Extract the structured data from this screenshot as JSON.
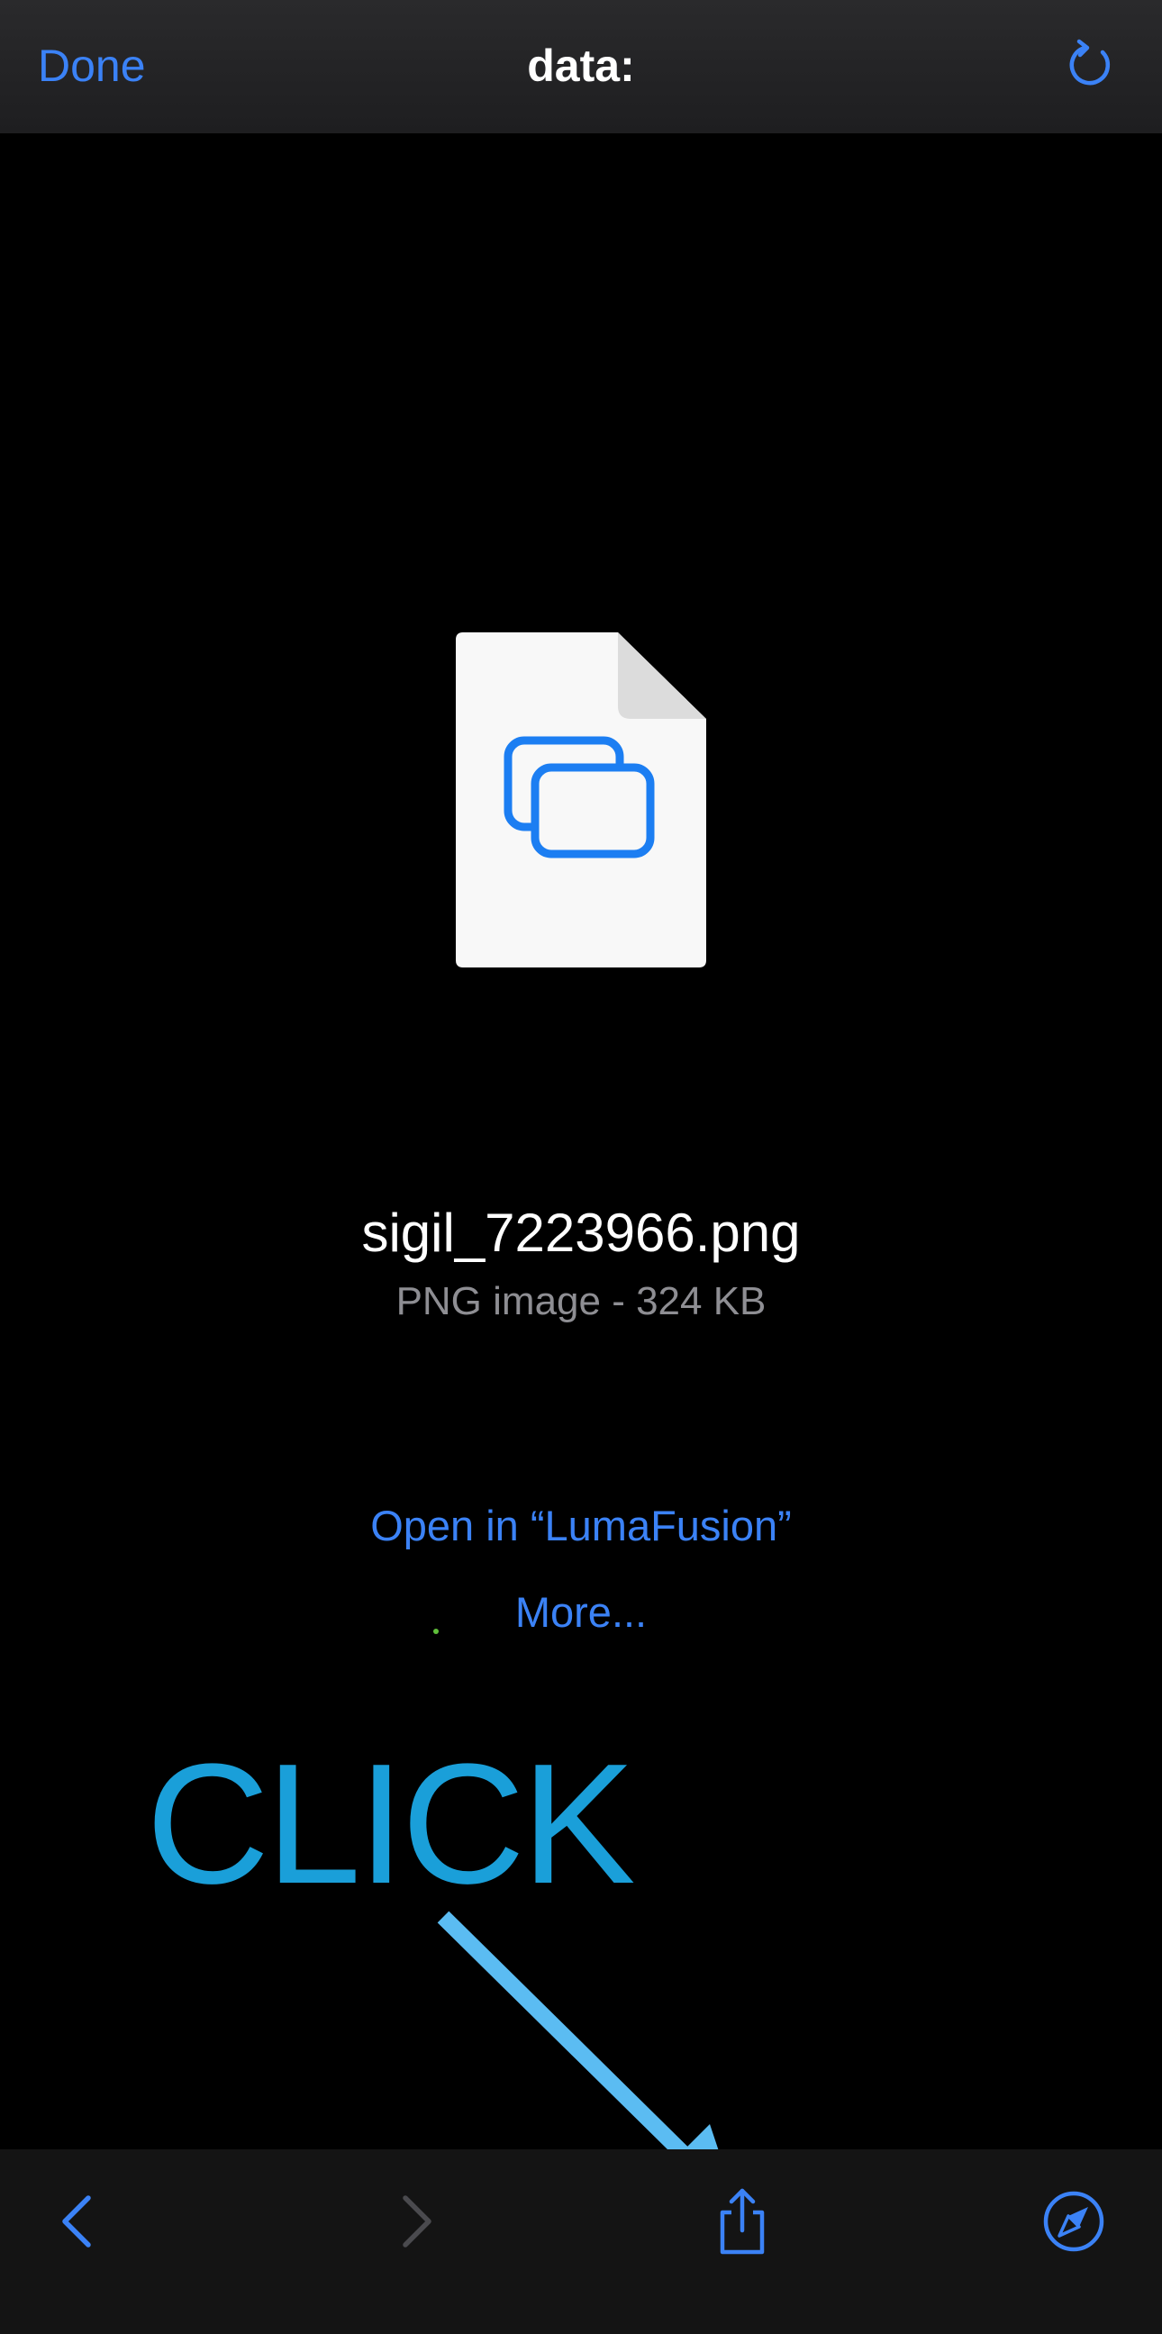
{
  "navbar": {
    "done_label": "Done",
    "title": "data:"
  },
  "file": {
    "name": "sigil_7223966.png",
    "meta": "PNG image - 324 KB"
  },
  "actions": {
    "open_in_label": "Open in “LumaFusion”",
    "more_label": "More..."
  },
  "annotation": {
    "label": "CLICK"
  },
  "toolbar": {
    "icons": [
      "back-icon",
      "forward-icon",
      "share-icon",
      "safari-compass-icon"
    ]
  },
  "colors": {
    "accent": "#3b82f6",
    "annotation": "#1a9fd9",
    "arrow": "#5bbcf2",
    "background": "#000000"
  }
}
